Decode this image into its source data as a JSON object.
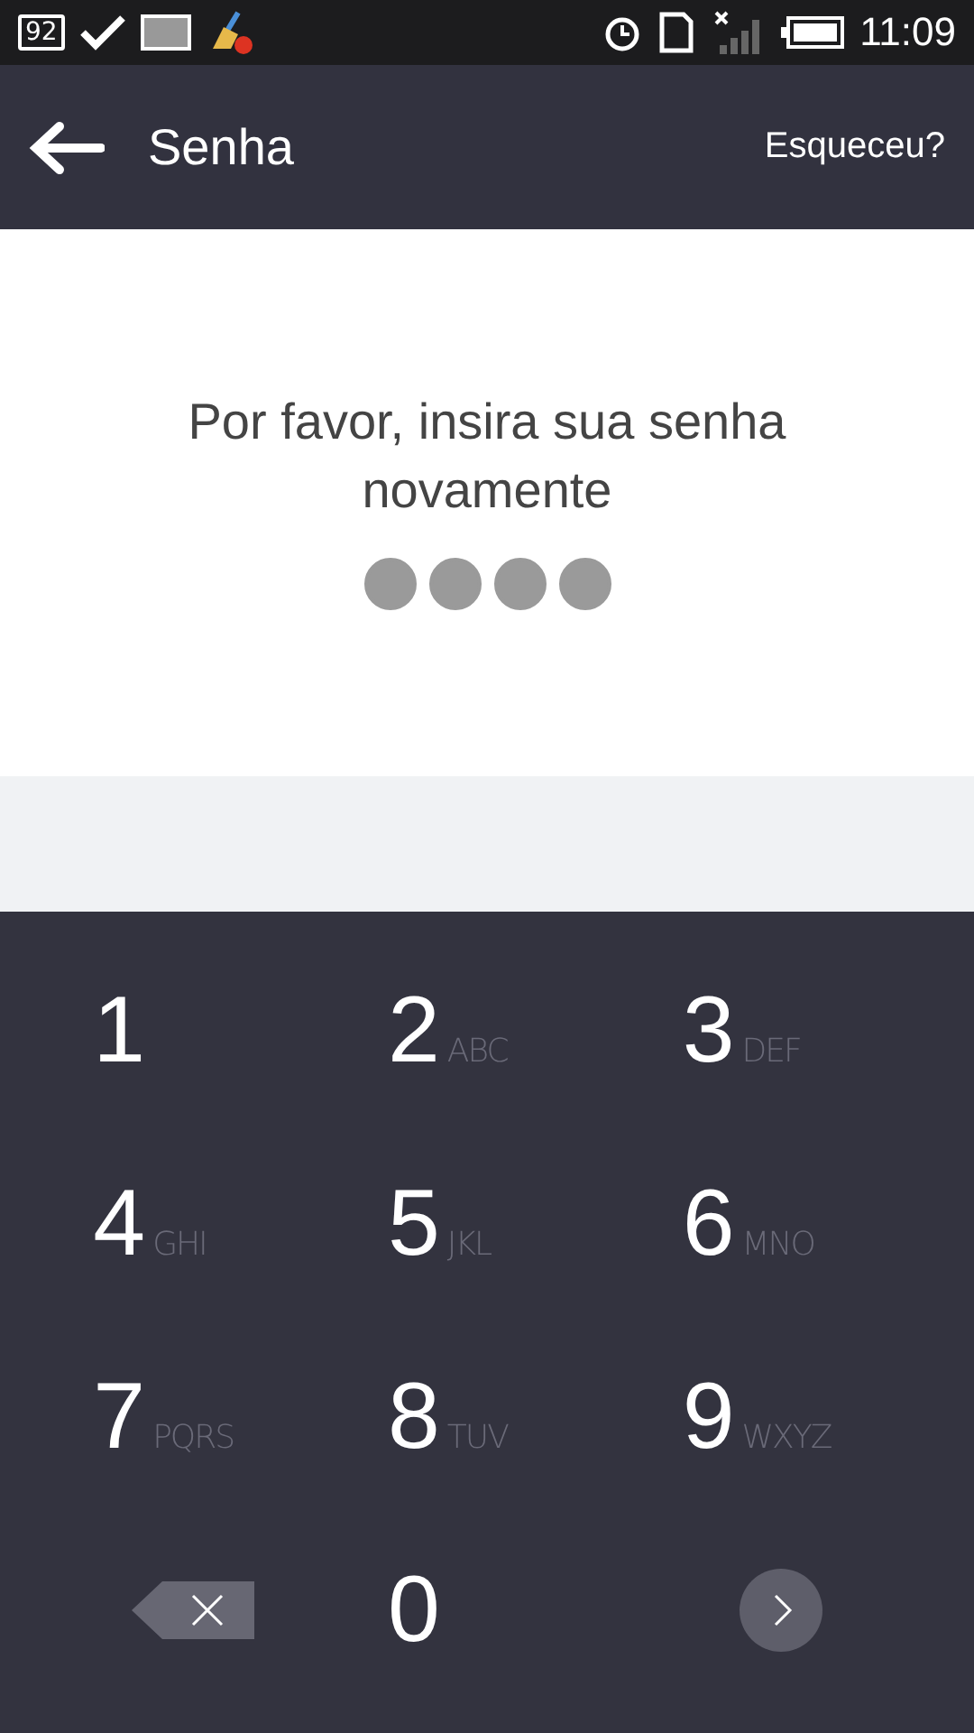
{
  "status_bar": {
    "notification_badge": "92",
    "time": "11:09"
  },
  "header": {
    "title": "Senha",
    "action": "Esqueceu?"
  },
  "prompt": "Por favor, insira sua senha novamente",
  "pin_dots": [
    {
      "filled": true
    },
    {
      "filled": true
    },
    {
      "filled": true
    },
    {
      "filled": true
    }
  ],
  "keypad": [
    {
      "kind": "digit",
      "digit": "1"
    },
    {
      "kind": "digit",
      "digit": "2",
      "letters": "ABC"
    },
    {
      "kind": "digit",
      "digit": "3",
      "letters": "DEF"
    },
    {
      "kind": "digit",
      "digit": "4",
      "letters": "GHI"
    },
    {
      "kind": "digit",
      "digit": "5",
      "letters": "JKL"
    },
    {
      "kind": "digit",
      "digit": "6",
      "letters": "MNO"
    },
    {
      "kind": "digit",
      "digit": "7",
      "letters": "PQRS"
    },
    {
      "kind": "digit",
      "digit": "8",
      "letters": "TUV"
    },
    {
      "kind": "digit",
      "digit": "9",
      "letters": "WXYZ"
    },
    {
      "kind": "delete"
    },
    {
      "kind": "digit",
      "digit": "0"
    },
    {
      "kind": "next"
    }
  ]
}
